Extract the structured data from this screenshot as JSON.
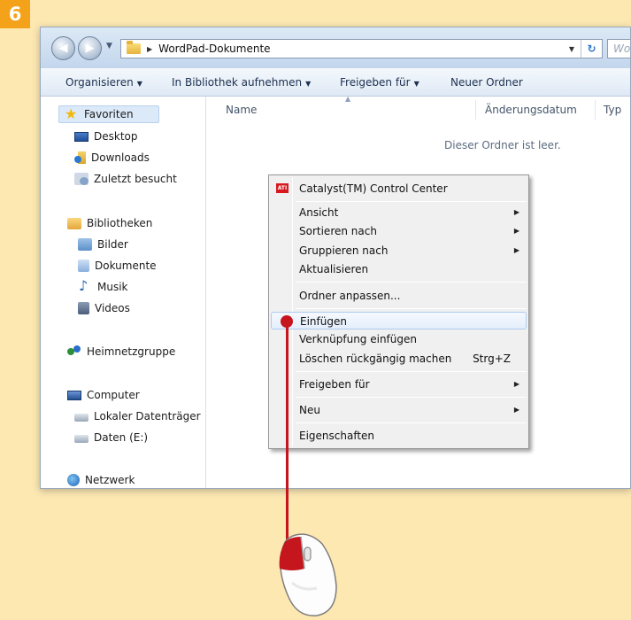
{
  "step_number": "6",
  "address_bar": {
    "path": "WordPad-Dokumente",
    "search_placeholder": "Wo"
  },
  "toolbar": {
    "organize": "Organisieren",
    "include_library": "In Bibliothek aufnehmen",
    "share": "Freigeben für",
    "new_folder": "Neuer Ordner"
  },
  "nav_pane": {
    "favorites": "Favoriten",
    "desktop": "Desktop",
    "downloads": "Downloads",
    "recent": "Zuletzt besucht",
    "libraries": "Bibliotheken",
    "pictures": "Bilder",
    "documents": "Dokumente",
    "music": "Musik",
    "videos": "Videos",
    "homegroup": "Heimnetzgruppe",
    "computer": "Computer",
    "local_disk": "Lokaler Datenträger",
    "data_drive": "Daten (E:)",
    "network": "Netzwerk"
  },
  "columns": {
    "name": "Name",
    "modified": "Änderungsdatum",
    "type": "Typ"
  },
  "empty_message": "Dieser Ordner ist leer.",
  "context_menu": {
    "catalyst": "Catalyst(TM) Control Center",
    "view": "Ansicht",
    "sort_by": "Sortieren nach",
    "group_by": "Gruppieren nach",
    "refresh": "Aktualisieren",
    "customize": "Ordner anpassen...",
    "paste": "Einfügen",
    "paste_shortcut": "Verknüpfung einfügen",
    "undo_delete": "Löschen rückgängig machen",
    "undo_shortcut": "Strg+Z",
    "share_with": "Freigeben für",
    "new": "Neu",
    "properties": "Eigenschaften",
    "ati_badge": "ATI"
  },
  "colors": {
    "accent_red": "#c4161c",
    "badge_orange": "#f3a21a",
    "page_background": "#fde8b2"
  }
}
